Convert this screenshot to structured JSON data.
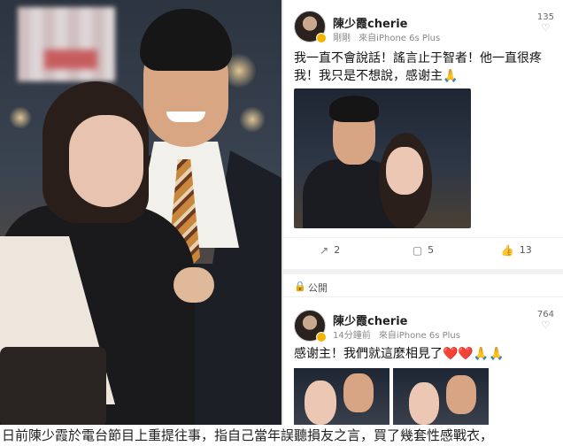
{
  "photo_left": {
    "blurred_region": "blurred-text"
  },
  "post1": {
    "username": "陳少霞cherie",
    "meta_time": "剛剛",
    "meta_source": "來自iPhone 6s Plus",
    "count": "135",
    "text": "我一直不會說話！謠言止于智者！他一直很疼我！我只是不想說，感谢主🙏",
    "actions": {
      "share": "2",
      "comment": "5",
      "like": "13"
    }
  },
  "public_bar": {
    "label": "公開"
  },
  "post2": {
    "username": "陳少霞cherie",
    "meta_time": "14分鐘前",
    "meta_source": "來自iPhone 6s Plus",
    "count": "764",
    "text": "感谢主！我們就這麼相見了❤️❤️🙏🙏"
  },
  "caption": "日前陳少霞於電台節目上重提往事，指自己當年誤聽損友之言，買了幾套性感戰衣，"
}
